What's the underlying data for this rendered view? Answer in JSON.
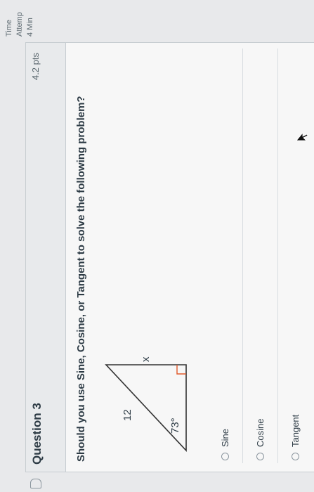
{
  "question": {
    "title": "Question 3",
    "points": "4.2 pts",
    "text": "Should you use Sine, Cosine, or Tangent to solve the following problem?"
  },
  "figure": {
    "side_label": "12",
    "unknown_label": "x",
    "angle_label": "73°"
  },
  "answers": [
    {
      "label": "Sine",
      "selected": false
    },
    {
      "label": "Cosine",
      "selected": false
    },
    {
      "label": "Tangent",
      "selected": false
    }
  ],
  "sidebar": {
    "time_label": "Time",
    "attempt_label": "Attemp",
    "minutes_label": "4 Min"
  }
}
